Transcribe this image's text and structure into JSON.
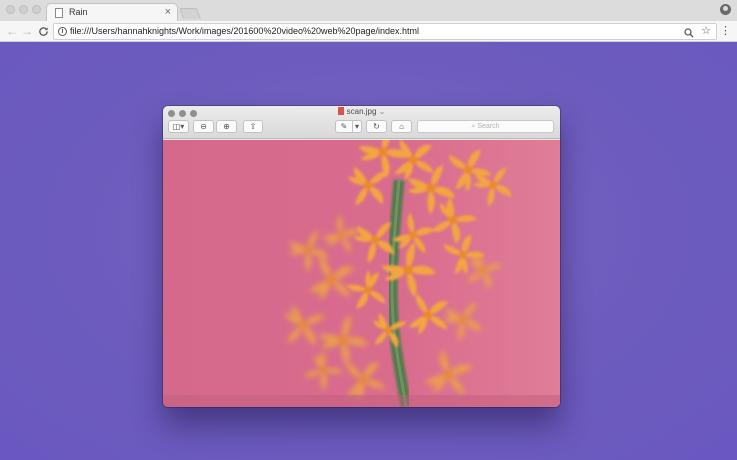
{
  "browser": {
    "tab_title": "Rain",
    "tab_close": "×",
    "url": "file:///Users/hannahknights/Work/images/201600%20video%20web%20page/index.html",
    "nav": {
      "back": "←",
      "forward": "→",
      "reload": "C"
    },
    "omnibox_icons": {
      "info": "i",
      "zoom": "zoom-icon",
      "bookmark": "☆"
    },
    "menu_dots": "⋮"
  },
  "preview_window": {
    "title": "scan.jpg",
    "title_chevron": "⌄",
    "search_placeholder": "Search",
    "toolbar": {
      "sidebar_icon": "◫▾",
      "zoom_out_icon": "⊖",
      "zoom_in_icon": "⊕",
      "share_icon": "⇧",
      "markup_icon": "✎",
      "markup_menu": "▾",
      "rotate_icon": "↻",
      "toolbox_icon": "⌂"
    }
  },
  "colors": {
    "page_background": "#7563c3",
    "photo_background": "#d56c8c",
    "flower_orange": "#f0a03a",
    "stem_green": "#4f7a4f"
  }
}
